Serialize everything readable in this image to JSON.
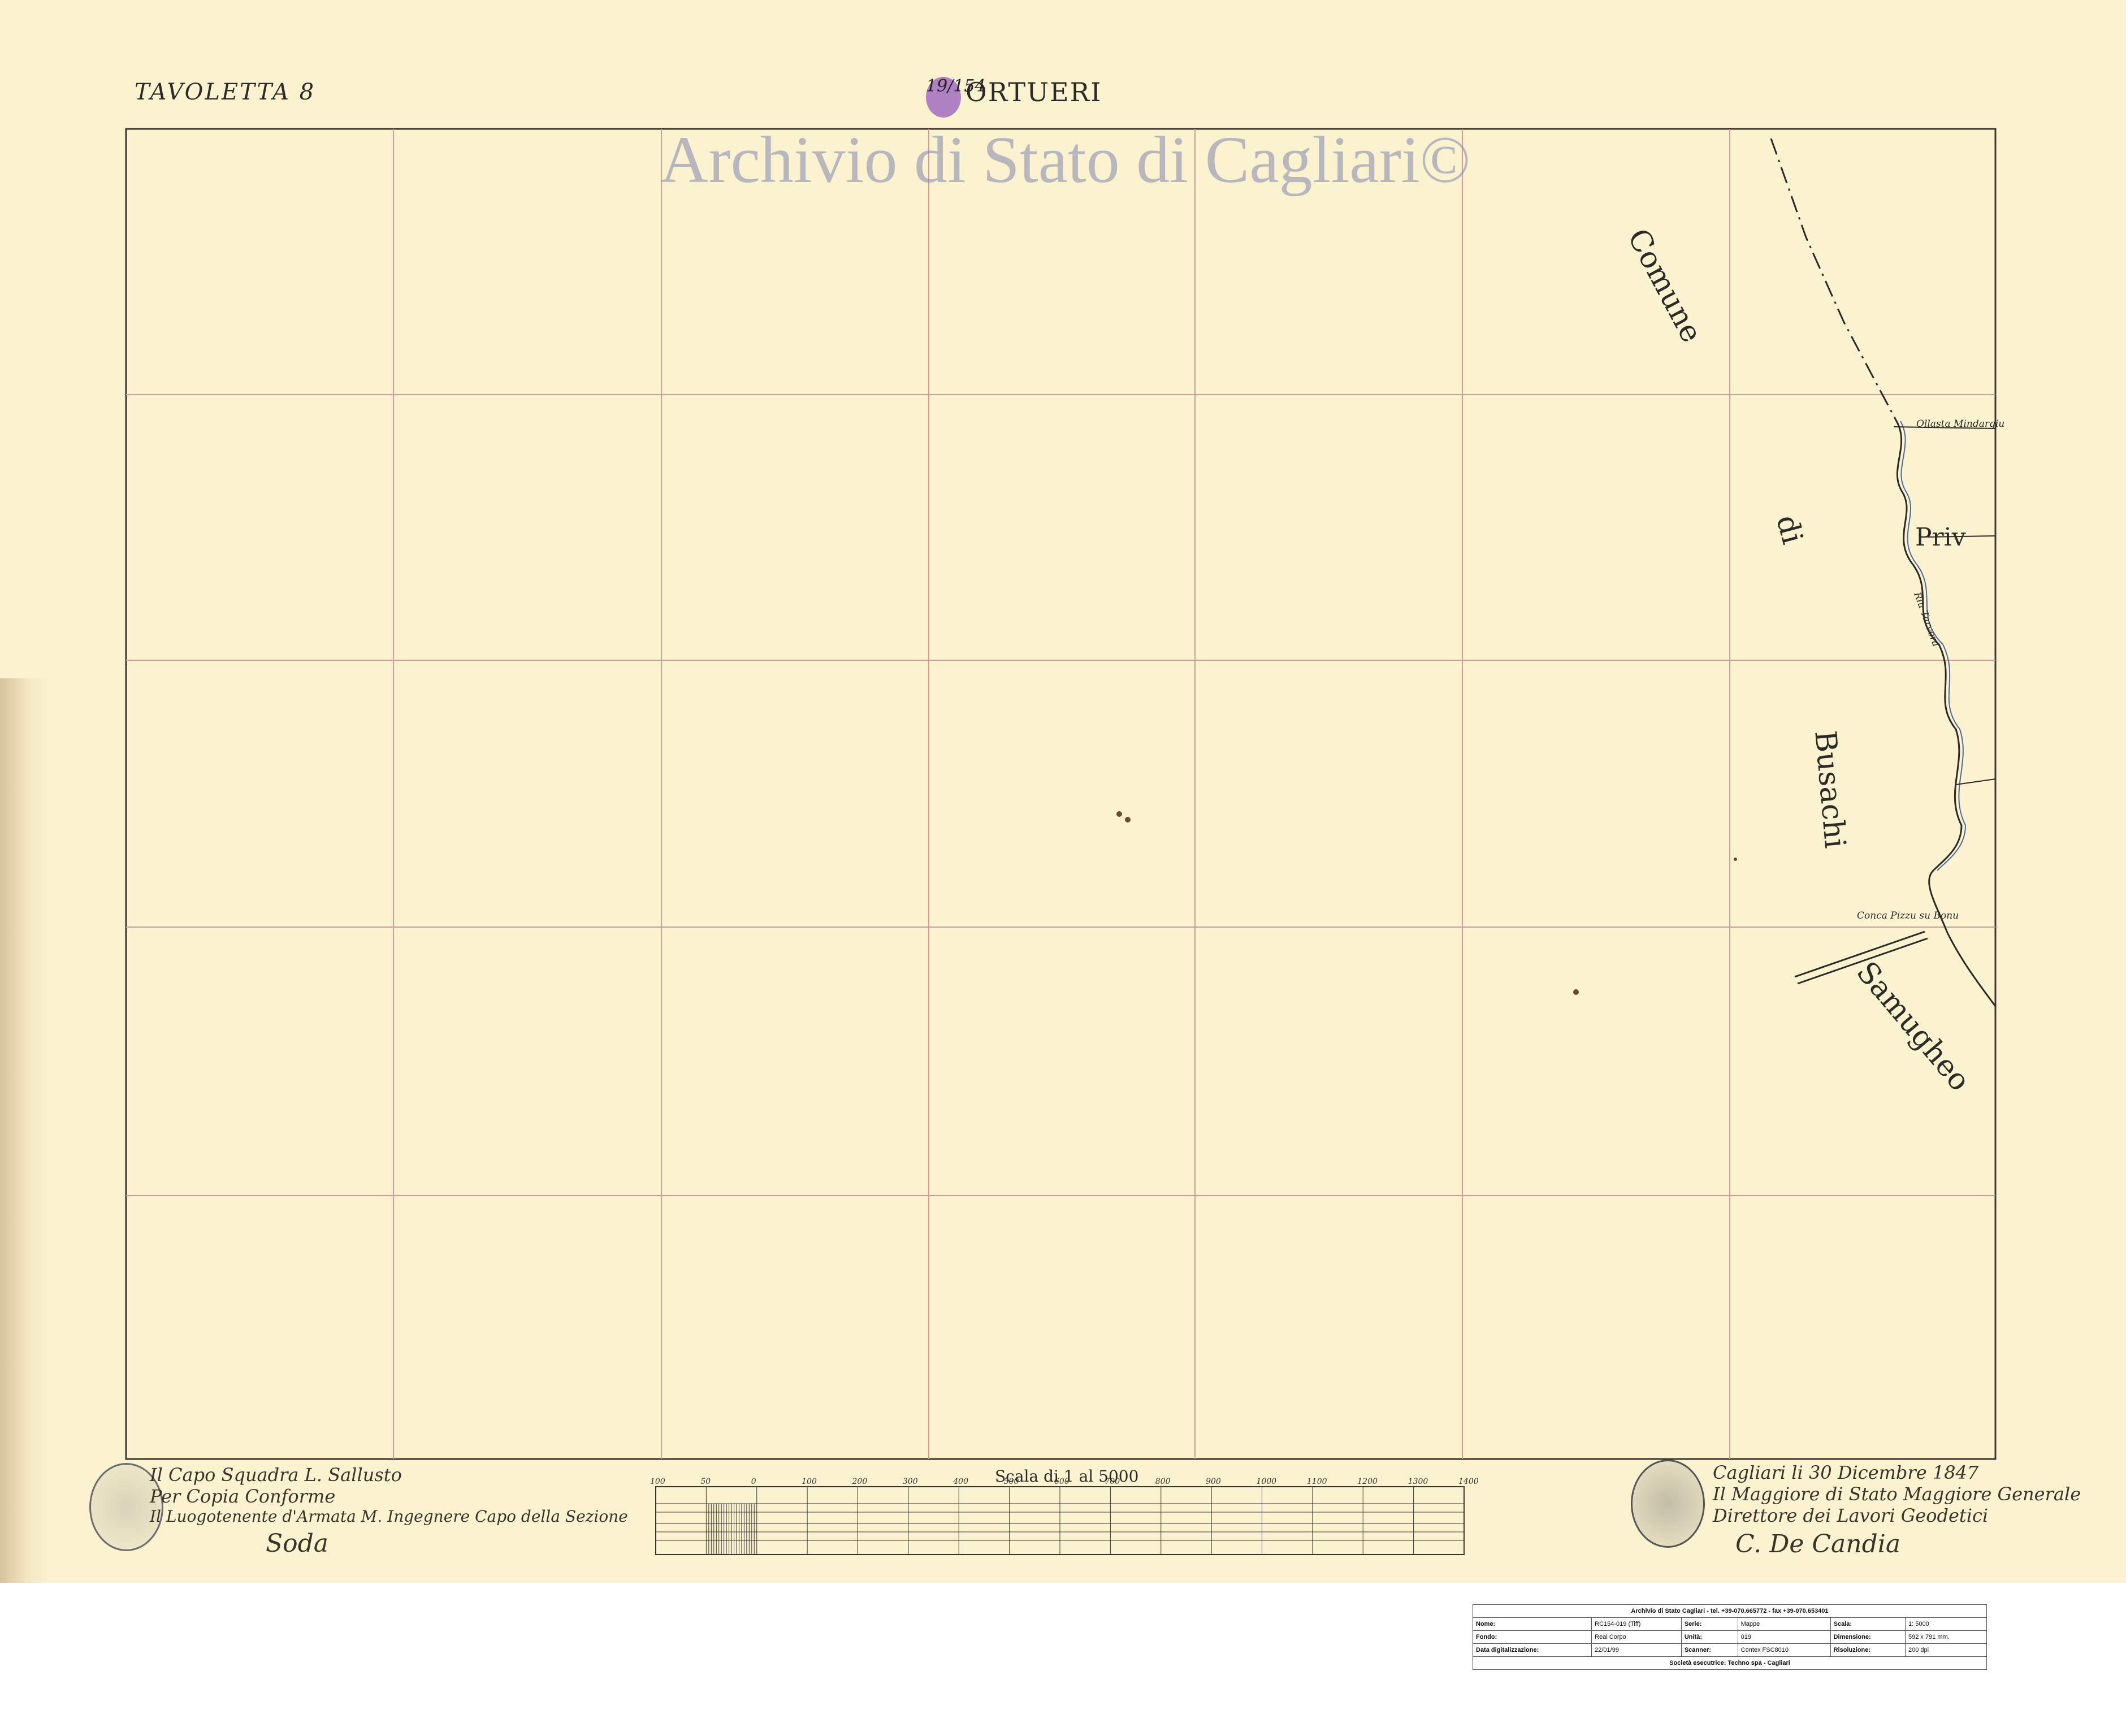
{
  "sheet": {
    "tavoletta": "TAVOLETTA 8",
    "title": "ORTUERI",
    "seal_text": "19/154",
    "watermark": "Archivio di Stato di Cagliari©"
  },
  "places": {
    "comune": "Comune",
    "di": "di",
    "privo": "Priv",
    "busachi": "Busachi",
    "samugheo": "Samugheo"
  },
  "small_labels": {
    "ollastra": "Ollasta Mindargiu",
    "riu": "Riu Tarvera",
    "conca": "Conca Pizzu  su Bonu"
  },
  "scale": {
    "title": "Scala di 1 al 5000",
    "ticks": [
      "100",
      "50",
      "0",
      "100",
      "200",
      "300",
      "400",
      "500",
      "600",
      "700",
      "800",
      "900",
      "1000",
      "1100",
      "1200",
      "1300",
      "1400"
    ]
  },
  "signatures": {
    "left_line1": "Il Capo Squadra  L. Sallusto",
    "left_line2": "Per Copia Conforme",
    "left_line3": "Il Luogotenente d'Armata  M. Ingegnere  Capo della Sezione",
    "left_sign": "Soda",
    "right_line1": "Cagliari li 30 Dicembre 1847",
    "right_line2": "Il Maggiore di Stato Maggiore Generale",
    "right_line3": "Direttore dei Lavori Geodetici",
    "right_sign": "C. De Candia"
  },
  "info": {
    "header": "Archivio di Stato Cagliari - tel. +39-070.665772 - fax +39-070.653401",
    "rows": [
      [
        "Nome:",
        "RC154-019 (Tiff)",
        "Serie:",
        "Mappe",
        "Scala:",
        "1: 5000"
      ],
      [
        "Fondo:",
        "Real Corpo",
        "Unità:",
        "019",
        "Dimensione:",
        "592 x 791  mm."
      ],
      [
        "Data digitalizzazione:",
        "22/01/99",
        "Scanner:",
        "Contex FSC8010",
        "Risoluzione:",
        "200 dpi"
      ]
    ],
    "footer": "Società esecutrice: Techno spa - Cagliari"
  },
  "colors": {
    "paper": "#fbf2d0",
    "grid_red": "#d49a9a",
    "ink": "#2b2a26",
    "watermark": "#8287af"
  }
}
